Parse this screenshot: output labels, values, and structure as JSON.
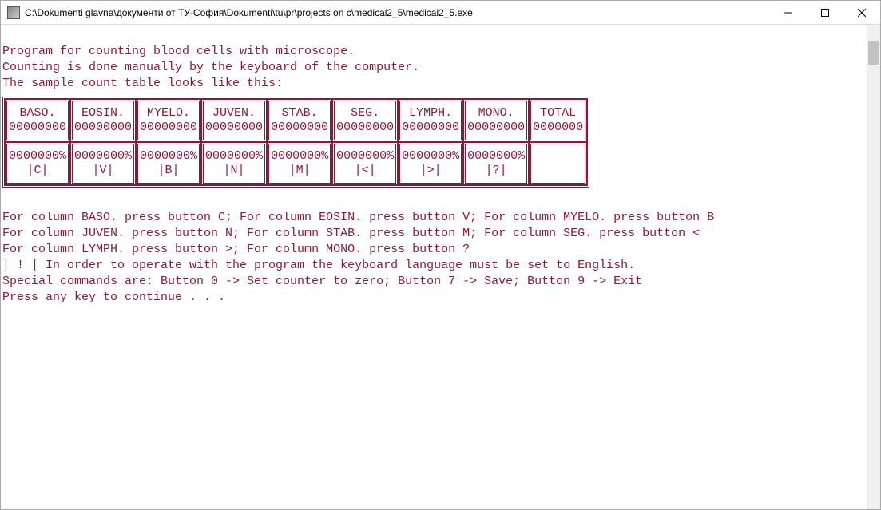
{
  "window": {
    "title": "C:\\Dokumenti glavna\\документи от ТУ-София\\Dokumenti\\tu\\pr\\projects on c\\medical2_5\\medical2_5.exe"
  },
  "intro": {
    "line1": "Program for counting blood cells with microscope.",
    "line2": "Counting is done manually by the keyboard of the computer.",
    "line3": "The sample count table looks like this:"
  },
  "table": {
    "columns": [
      {
        "header": "BASO.",
        "count": "00000000",
        "percent": "0000000%",
        "key": "|C|"
      },
      {
        "header": "EOSIN.",
        "count": "00000000",
        "percent": "0000000%",
        "key": "|V|"
      },
      {
        "header": "MYELO.",
        "count": "00000000",
        "percent": "0000000%",
        "key": "|B|"
      },
      {
        "header": "JUVEN.",
        "count": "00000000",
        "percent": "0000000%",
        "key": "|N|"
      },
      {
        "header": "STAB.",
        "count": "00000000",
        "percent": "0000000%",
        "key": "|M|"
      },
      {
        "header": "SEG.",
        "count": "00000000",
        "percent": "0000000%",
        "key": "|<|"
      },
      {
        "header": "LYMPH.",
        "count": "00000000",
        "percent": "0000000%",
        "key": "|>|"
      },
      {
        "header": "MONO.",
        "count": "00000000",
        "percent": "0000000%",
        "key": "|?|"
      }
    ],
    "total": {
      "header": "TOTAL",
      "count": "0000000"
    }
  },
  "help": {
    "l1": "For column BASO. press button C; For column EOSIN. press button V; For column MYELO. press button B",
    "l2": "For column JUVEN. press button N; For column STAB. press button M; For column SEG. press button <",
    "l3": "For column LYMPH. press button >; For column MONO. press button ?",
    "l4": "| ! | In order to operate with the program the keyboard language must be set to English.",
    "l5": "Special commands are: Button 0 -> Set counter to zero; Button 7 -> Save; Button 9 -> Exit",
    "l6": "Press any key to continue . . ."
  }
}
